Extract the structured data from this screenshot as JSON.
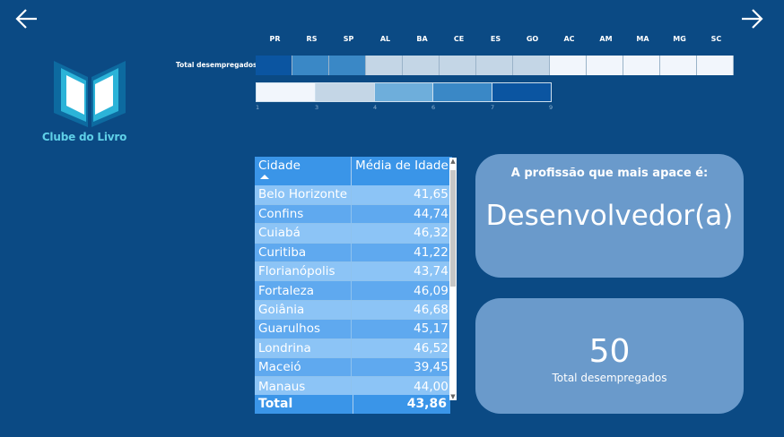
{
  "nav": {
    "back_icon": "arrow-left-icon",
    "forward_icon": "arrow-right-icon"
  },
  "logo": {
    "caption": "Clube do Livro",
    "icon": "open-book-icon"
  },
  "matrix": {
    "row_label": "Total desempregados",
    "columns": [
      "PR",
      "RS",
      "SP",
      "AL",
      "BA",
      "CE",
      "ES",
      "GO",
      "AC",
      "AM",
      "MA",
      "MG",
      "SC"
    ],
    "cell_colors": [
      "#0b55a1",
      "#3a88c6",
      "#3a88c6",
      "#c4d6e6",
      "#c4d6e6",
      "#c4d6e6",
      "#c4d6e6",
      "#c4d6e6",
      "#f2f6fc",
      "#f2f6fc",
      "#f2f6fc",
      "#f2f6fc",
      "#f2f6fc"
    ]
  },
  "legend": {
    "colors": [
      "#f2f6fc",
      "#c4d6e6",
      "#6eaedb",
      "#3a88c6",
      "#0b55a1"
    ],
    "ticks": [
      "1",
      "3",
      "4",
      "6",
      "7",
      "9"
    ]
  },
  "table": {
    "headers": [
      "Cidade",
      "Média de Idade"
    ],
    "rows": [
      [
        "Belo Horizonte",
        "41,65"
      ],
      [
        "Confins",
        "44,74"
      ],
      [
        "Cuiabá",
        "46,32"
      ],
      [
        "Curitiba",
        "41,22"
      ],
      [
        "Florianópolis",
        "43,74"
      ],
      [
        "Fortaleza",
        "46,09"
      ],
      [
        "Goiânia",
        "46,68"
      ],
      [
        "Guarulhos",
        "45,17"
      ],
      [
        "Londrina",
        "46,52"
      ],
      [
        "Maceió",
        "39,45"
      ],
      [
        "Manaus",
        "44,00"
      ]
    ],
    "total_label": "Total",
    "total_value": "43,86"
  },
  "cards": {
    "profession_title": "A profissão que mais apace é:",
    "profession_value": "Desenvolvedor(a)",
    "unemployed_value": "50",
    "unemployed_label": "Total desempregados"
  }
}
